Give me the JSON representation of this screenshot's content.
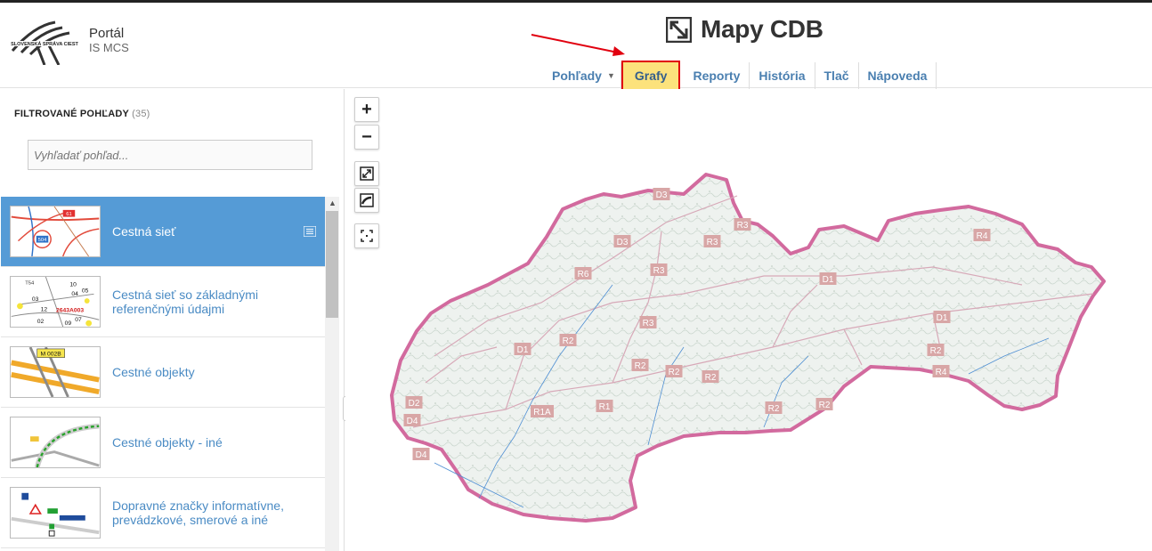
{
  "header": {
    "portal_title": "Portál",
    "portal_subtitle": "IS MCS",
    "logo_text": "SLOVENSKÁ SPRÁVA CIEST",
    "app_title": "Mapy CDB"
  },
  "nav": {
    "items": [
      {
        "label": "Pohľady",
        "has_dropdown": true
      },
      {
        "label": "Grafy",
        "active": true
      },
      {
        "label": "Reporty"
      },
      {
        "label": "História"
      },
      {
        "label": "Tlač"
      },
      {
        "label": "Nápoveda"
      }
    ]
  },
  "sidebar": {
    "title": "FILTROVANÉ POHĽADY",
    "count": "(35)",
    "search_placeholder": "Vyhľadať pohľad...",
    "items": [
      {
        "label": "Cestná sieť",
        "selected": true,
        "thumb": "road-network",
        "thumb_badge_1": "61",
        "thumb_badge_2": "504"
      },
      {
        "label": "Cestná sieť so základnými referenčnými údajmi",
        "thumb": "reference-data",
        "thumb_text_1": "T54",
        "thumb_text_2": "2643A003",
        "thumb_nums": [
          "10",
          "03",
          "04",
          "05",
          "12",
          "02",
          "09",
          "07"
        ]
      },
      {
        "label": "Cestné objekty",
        "thumb": "road-objects",
        "thumb_badge": "M 002B"
      },
      {
        "label": "Cestné objekty - iné",
        "thumb": "road-objects-other"
      },
      {
        "label": "Dopravné značky informatívne, prevádzkové, smerové a iné",
        "thumb": "traffic-signs"
      }
    ]
  },
  "map": {
    "tools": [
      "zoom-in",
      "zoom-out",
      "fullscreen",
      "measure",
      "extent"
    ],
    "road_labels": [
      {
        "text": "D3"
      },
      {
        "text": "D3"
      },
      {
        "text": "R3"
      },
      {
        "text": "R3"
      },
      {
        "text": "R3"
      },
      {
        "text": "R3"
      },
      {
        "text": "R6"
      },
      {
        "text": "R4"
      },
      {
        "text": "D1"
      },
      {
        "text": "D1"
      },
      {
        "text": "D1"
      },
      {
        "text": "R2"
      },
      {
        "text": "R2"
      },
      {
        "text": "R2"
      },
      {
        "text": "R2"
      },
      {
        "text": "R2"
      },
      {
        "text": "R2"
      },
      {
        "text": "R2"
      },
      {
        "text": "R4"
      },
      {
        "text": "R1A"
      },
      {
        "text": "R1"
      },
      {
        "text": "D2"
      },
      {
        "text": "D4"
      },
      {
        "text": "D4"
      }
    ],
    "colors": {
      "border": "#d26a9e",
      "label_bg": "#d8a6a6",
      "terrain": "#e8eee9"
    }
  }
}
